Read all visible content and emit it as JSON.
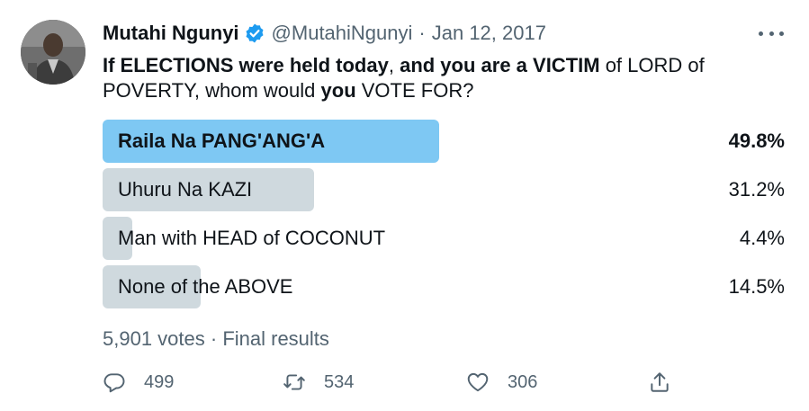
{
  "tweet": {
    "author": {
      "name": "Mutahi Ngunyi",
      "handle": "@MutahiNgunyi",
      "separator": "·",
      "date": "Jan 12, 2017",
      "verified": true
    },
    "text": {
      "p1": "If ELECTIONS were held today",
      "p2": ", ",
      "p3": "and you are a VICTIM",
      "p4": " of LORD of POVERTY, whom would ",
      "p5": "you",
      "p6": " VOTE FOR?"
    },
    "poll": {
      "options": [
        {
          "label": "Raila Na PANG'ANG'A",
          "percent_text": "49.8%",
          "percent": 49.8,
          "winner": true
        },
        {
          "label": "Uhuru Na KAZI",
          "percent_text": "31.2%",
          "percent": 31.2,
          "winner": false
        },
        {
          "label": "Man with HEAD of COCONUT",
          "percent_text": "4.4%",
          "percent": 4.4,
          "winner": false
        },
        {
          "label": "None of the ABOVE",
          "percent_text": "14.5%",
          "percent": 14.5,
          "winner": false
        }
      ],
      "votes_text": "5,901 votes",
      "separator": "·",
      "status": "Final results"
    },
    "actions": {
      "replies": "499",
      "retweets": "534",
      "likes": "306"
    },
    "icons": {
      "verified": "verified-badge-icon",
      "more": "more-options-icon",
      "reply": "reply-icon",
      "retweet": "retweet-icon",
      "like": "heart-icon",
      "share": "share-icon"
    },
    "colors": {
      "winner_bar": "#7ec8f3",
      "bar": "#cfd9de",
      "verified": "#1d9bf0",
      "secondary_text": "#536471"
    }
  }
}
